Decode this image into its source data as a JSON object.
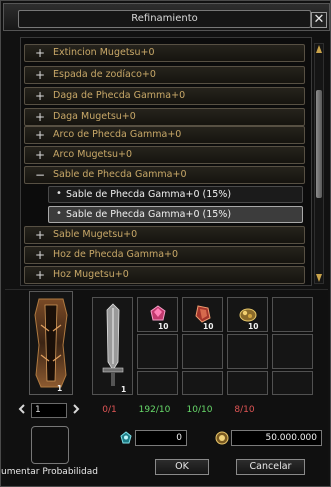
{
  "window": {
    "title": "Refinamiento",
    "close": "✕"
  },
  "list": {
    "items": [
      {
        "sign": "+",
        "label": "Extincion Mugetsu+0"
      },
      {
        "sign": "+",
        "label": "Espada de zodíaco+0"
      },
      {
        "sign": "+",
        "label": "Daga de Phecda Gamma+0"
      },
      {
        "sign": "+",
        "label": "Daga Mugetsu+0"
      },
      {
        "sign": "+",
        "label": "Arco de Phecda Gamma+0"
      },
      {
        "sign": "+",
        "label": "Arco Mugetsu+0"
      },
      {
        "sign": "−",
        "label": "Sable de Phecda Gamma+0"
      },
      {
        "sign": "+",
        "label": "Sable Mugetsu+0"
      },
      {
        "sign": "+",
        "label": "Hoz de Phecda Gamma+0"
      },
      {
        "sign": "+",
        "label": "Hoz Mugetsu+0"
      }
    ],
    "subitems": [
      {
        "bullet": "•",
        "label": "Sable de Phecda Gamma+0 (15%)",
        "selected": false
      },
      {
        "bullet": "•",
        "label": "Sable de Phecda Gamma+0 (15%)",
        "selected": true
      }
    ]
  },
  "materials": {
    "target_qty": "1",
    "sword_qty": "1",
    "gem_pink_qty": "10",
    "gem_red_qty": "10",
    "ore_gold_qty": "10",
    "page": "1",
    "counts": [
      {
        "text": "0/1",
        "color": "#e05555"
      },
      {
        "text": "192/10",
        "color": "#67d96a"
      },
      {
        "text": "10/10",
        "color": "#67d96a"
      },
      {
        "text": "8/10",
        "color": "#e05555"
      }
    ]
  },
  "bottom": {
    "chance_label": "umentar Probabilidad",
    "gem_value": "0",
    "gold_value": "50.000.000",
    "ok_label": "OK",
    "cancel_label": "Cancelar"
  },
  "icons": {
    "close": "close-icon",
    "plus": "plus-icon",
    "minus": "minus-icon",
    "prev": "chevron-left-icon",
    "next": "chevron-right-icon",
    "gem_currency": "gem-icon",
    "gold_currency": "gold-coin-icon"
  },
  "colors": {
    "accent": "#c8a868",
    "positive": "#67d96a",
    "negative": "#e05555"
  }
}
